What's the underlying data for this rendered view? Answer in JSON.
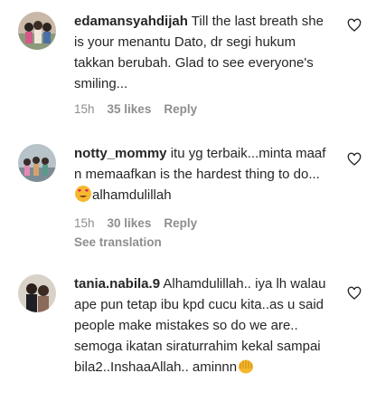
{
  "comments": [
    {
      "username": "edamansyahdijah",
      "text": "Till the last breath she is your menantu Dato, dr segi hukum takkan berubah. Glad to see everyone's smiling...",
      "time": "15h",
      "likes": "35 likes",
      "reply": "Reply",
      "avatar_icon": "user-avatar"
    },
    {
      "username": "notty_mommy",
      "text_before": "itu yg terbaik...minta maaf n memaafkan is the hardest thing to do...",
      "emoji": "heart-eyes-emoji",
      "text_after": "alhamdulillah",
      "time": "15h",
      "likes": "30 likes",
      "reply": "Reply",
      "see_translation": "See translation",
      "avatar_icon": "user-avatar"
    },
    {
      "username": "tania.nabila.9",
      "text_before": "Alhamdulillah.. iya lh walau ape pun tetap ibu kpd cucu kita..as u said people make mistakes so do we are.. semoga ikatan siraturrahim kekal sampai bila2..InshaaAllah.. aminnn",
      "emoji": "clapping-hands-emoji",
      "avatar_icon": "user-avatar"
    }
  ],
  "colors": {
    "text": "#262626",
    "secondary": "#8e8e8e",
    "emoji": "#f5b82e"
  }
}
